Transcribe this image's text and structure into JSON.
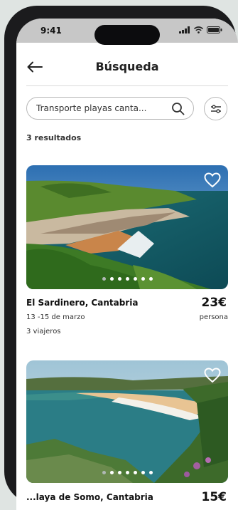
{
  "status_bar": {
    "time": "9:41"
  },
  "header": {
    "title": "Búsqueda"
  },
  "search": {
    "value": "Transporte playas canta..."
  },
  "results": {
    "count_label": "3 resultados"
  },
  "cards": [
    {
      "name": "El Sardinero, Cantabria",
      "dates": "13 -15 de marzo",
      "guests": "3 viajeros",
      "price": "23€",
      "unit": "persona",
      "image_dots": 7,
      "active_dot": 0
    },
    {
      "name": "...laya de Somo, Cantabria",
      "price": "15€",
      "image_dots": 7,
      "active_dot": 0
    }
  ]
}
